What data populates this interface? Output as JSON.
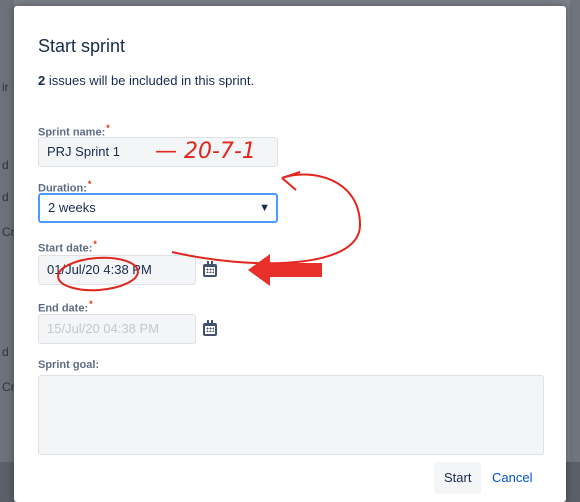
{
  "dialog": {
    "title": "Start sprint",
    "info_count": "2",
    "info_text": " issues will be included in this sprint.",
    "sprint_name_label": "Sprint name:",
    "sprint_name_value": "PRJ Sprint 1",
    "duration_label": "Duration:",
    "duration_value": "2 weeks",
    "start_date_label": "Start date:",
    "start_date_value": "01/Jul/20 4:38 PM",
    "end_date_label": "End date:",
    "end_date_value": "15/Jul/20 04:38 PM",
    "sprint_goal_label": "Sprint goal:",
    "required_mark": "*",
    "start_button": "Start",
    "cancel_button": "Cancel"
  },
  "annotation": {
    "handwritten_text": "— 20-7-1",
    "color": "#e0261d"
  },
  "background": {
    "letters": [
      "ir",
      "d",
      "d",
      "Cr",
      "d",
      "Cr"
    ]
  },
  "icons": {
    "calendar": "calendar-icon",
    "dropdown": "chevron-down-icon"
  }
}
